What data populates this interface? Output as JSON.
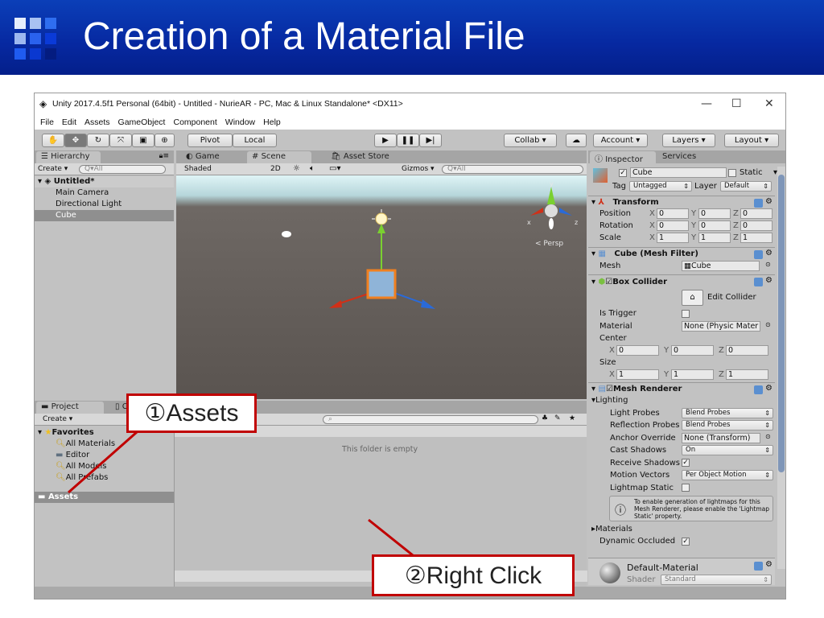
{
  "slide": {
    "title": "Creation of a Material File",
    "accent": "#0628a0",
    "callout_color": "#c00000"
  },
  "window": {
    "title": "Unity 2017.4.5f1 Personal (64bit) - Untitled - NurieAR - PC, Mac & Linux Standalone* <DX11>",
    "controls": {
      "minimize": "—",
      "maximize": "☐",
      "close": "✕"
    },
    "menu": [
      "File",
      "Edit",
      "Assets",
      "GameObject",
      "Component",
      "Window",
      "Help"
    ]
  },
  "toolbar": {
    "tools": [
      "hand-icon",
      "move-icon",
      "rotate-icon",
      "scale-icon",
      "rect-icon",
      "transform-icon"
    ],
    "pivot": "Pivot",
    "local": "Local",
    "collab": "Collab ▾",
    "account": "Account ▾",
    "layers": "Layers ▾",
    "layout": "Layout ▾"
  },
  "hierarchy": {
    "tab": "Hierarchy",
    "create": "Create ▾",
    "search": "Q▾All",
    "scene": "Untitled*",
    "items": [
      "Main Camera",
      "Directional Light",
      "Cube"
    ],
    "selected": "Cube"
  },
  "scene": {
    "tabs": [
      "Game",
      "Scene",
      "Asset Store"
    ],
    "active_tab": "Scene",
    "shading": "Shaded",
    "mode2d": "2D",
    "gizmos": "Gizmos ▾",
    "search": "Q▾All",
    "persp": "< Persp",
    "axes": {
      "x": "x",
      "y": "y",
      "z": "z"
    }
  },
  "project": {
    "tabs": [
      "Project",
      "C"
    ],
    "create": "Create ▾",
    "favorites": "Favorites",
    "favorite_items": [
      "All Materials",
      "Editor",
      "All Models",
      "All Prefabs"
    ],
    "assets": "Assets",
    "empty": "This folder is empty"
  },
  "inspector": {
    "tabs": [
      "Inspector",
      "Services"
    ],
    "object": {
      "name": "Cube",
      "active": true,
      "static": "Static",
      "tag_label": "Tag",
      "tag": "Untagged",
      "layer_label": "Layer",
      "layer": "Default"
    },
    "transform": {
      "title": "Transform",
      "rows": [
        {
          "label": "Position",
          "x": "0",
          "y": "0",
          "z": "0"
        },
        {
          "label": "Rotation",
          "x": "0",
          "y": "0",
          "z": "0"
        },
        {
          "label": "Scale",
          "x": "1",
          "y": "1",
          "z": "1"
        }
      ]
    },
    "mesh_filter": {
      "title": "Cube (Mesh Filter)",
      "mesh_label": "Mesh",
      "mesh": "Cube"
    },
    "box_collider": {
      "title": "Box Collider",
      "edit": "Edit Collider",
      "is_trigger": "Is Trigger",
      "material_label": "Material",
      "material": "None (Physic Mater",
      "center_label": "Center",
      "center": {
        "x": "0",
        "y": "0",
        "z": "0"
      },
      "size_label": "Size",
      "size": {
        "x": "1",
        "y": "1",
        "z": "1"
      }
    },
    "mesh_renderer": {
      "title": "Mesh Renderer",
      "lighting": "Lighting",
      "light_probes_label": "Light Probes",
      "light_probes": "Blend Probes",
      "reflection_probes_label": "Reflection Probes",
      "reflection_probes": "Blend Probes",
      "anchor_label": "Anchor Override",
      "anchor": "None (Transform)",
      "cast_shadows_label": "Cast Shadows",
      "cast_shadows": "On",
      "receive_shadows_label": "Receive Shadows",
      "receive_shadows": true,
      "motion_vectors_label": "Motion Vectors",
      "motion_vectors": "Per Object Motion",
      "lightmap_static_label": "Lightmap Static",
      "lightmap_static": false,
      "info": "To enable generation of lightmaps for this Mesh Renderer, please enable the 'Lightmap Static' property.",
      "materials": "Materials",
      "dynamic_occluded_label": "Dynamic Occluded",
      "dynamic_occluded": true
    },
    "material": {
      "name": "Default-Material",
      "shader_label": "Shader",
      "shader": "Standard"
    }
  },
  "callouts": {
    "one": "①Assets",
    "two": "②Right Click"
  }
}
